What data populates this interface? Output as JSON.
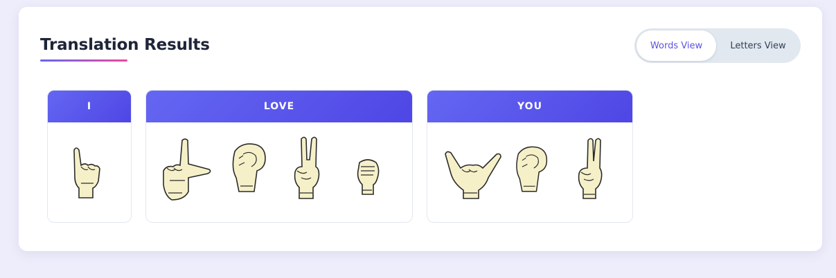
{
  "header": {
    "title": "Translation Results"
  },
  "view_toggle": {
    "options": [
      "Words View",
      "Letters View"
    ],
    "selected": "Words View"
  },
  "words": [
    {
      "word": "I",
      "letters": [
        "I"
      ]
    },
    {
      "word": "LOVE",
      "letters": [
        "L",
        "O",
        "V",
        "E"
      ]
    },
    {
      "word": "YOU",
      "letters": [
        "Y",
        "O",
        "U"
      ]
    }
  ],
  "colors": {
    "accent": "#4f46e5",
    "accent_light": "#6366f1",
    "underline_end": "#ec4899",
    "page_bg": "#eeedfb",
    "hand_fill": "#f5f0c8"
  }
}
